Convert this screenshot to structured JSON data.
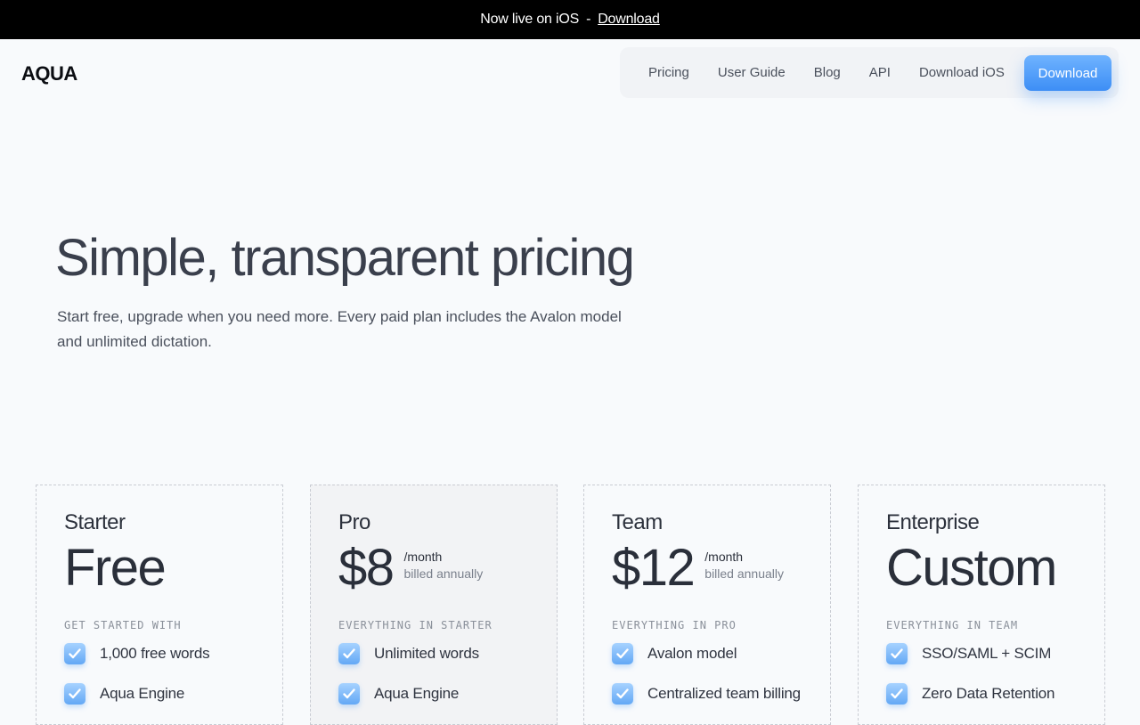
{
  "banner": {
    "text": "Now live on iOS",
    "separator": "-",
    "link": "Download"
  },
  "header": {
    "logo": "AQUA",
    "nav": [
      "Pricing",
      "User Guide",
      "Blog",
      "API",
      "Download iOS"
    ],
    "cta": "Download"
  },
  "hero": {
    "title": "Simple, transparent pricing",
    "subtitle": "Start free, upgrade when you need more. Every paid plan includes the Avalon model and unlimited dictation."
  },
  "plans": [
    {
      "name": "Starter",
      "price": "Free",
      "period": "",
      "billed": "",
      "section": "GET STARTED WITH",
      "features": [
        "1,000 free words",
        "Aqua Engine"
      ]
    },
    {
      "name": "Pro",
      "price": "$8",
      "period": "/month",
      "billed": "billed annually",
      "section": "EVERYTHING IN STARTER",
      "features": [
        "Unlimited words",
        "Aqua Engine"
      ]
    },
    {
      "name": "Team",
      "price": "$12",
      "period": "/month",
      "billed": "billed annually",
      "section": "EVERYTHING IN PRO",
      "features": [
        "Avalon model",
        "Centralized team billing"
      ]
    },
    {
      "name": "Enterprise",
      "price": "Custom",
      "period": "",
      "billed": "",
      "section": "EVERYTHING IN TEAM",
      "features": [
        "SSO/SAML + SCIM",
        "Zero Data Retention"
      ]
    }
  ],
  "colors": {
    "accent": "#3d8ef5",
    "banner_bg": "#000000",
    "page_bg": "#f8fafc"
  },
  "icons": {
    "feature_check": "checkmark-icon"
  }
}
